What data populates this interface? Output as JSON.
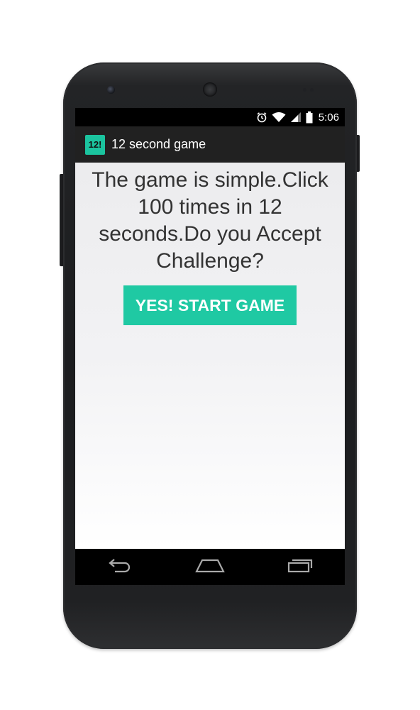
{
  "statusbar": {
    "time": "5:06",
    "icons": [
      "alarm-icon",
      "wifi-icon",
      "signal-icon",
      "battery-icon"
    ]
  },
  "actionbar": {
    "app_icon_text": "12!",
    "title": "12 second game"
  },
  "main": {
    "prompt": "The game is simple.Click 100 times in 12 seconds.Do you Accept Challenge?",
    "start_button_label": "YES! START GAME"
  },
  "navbar": {
    "icons": [
      "back-icon",
      "home-icon",
      "recents-icon"
    ]
  },
  "colors": {
    "accent": "#1fc9a3",
    "actionbar_bg": "#212121",
    "content_bg": "#f0f0f2"
  }
}
